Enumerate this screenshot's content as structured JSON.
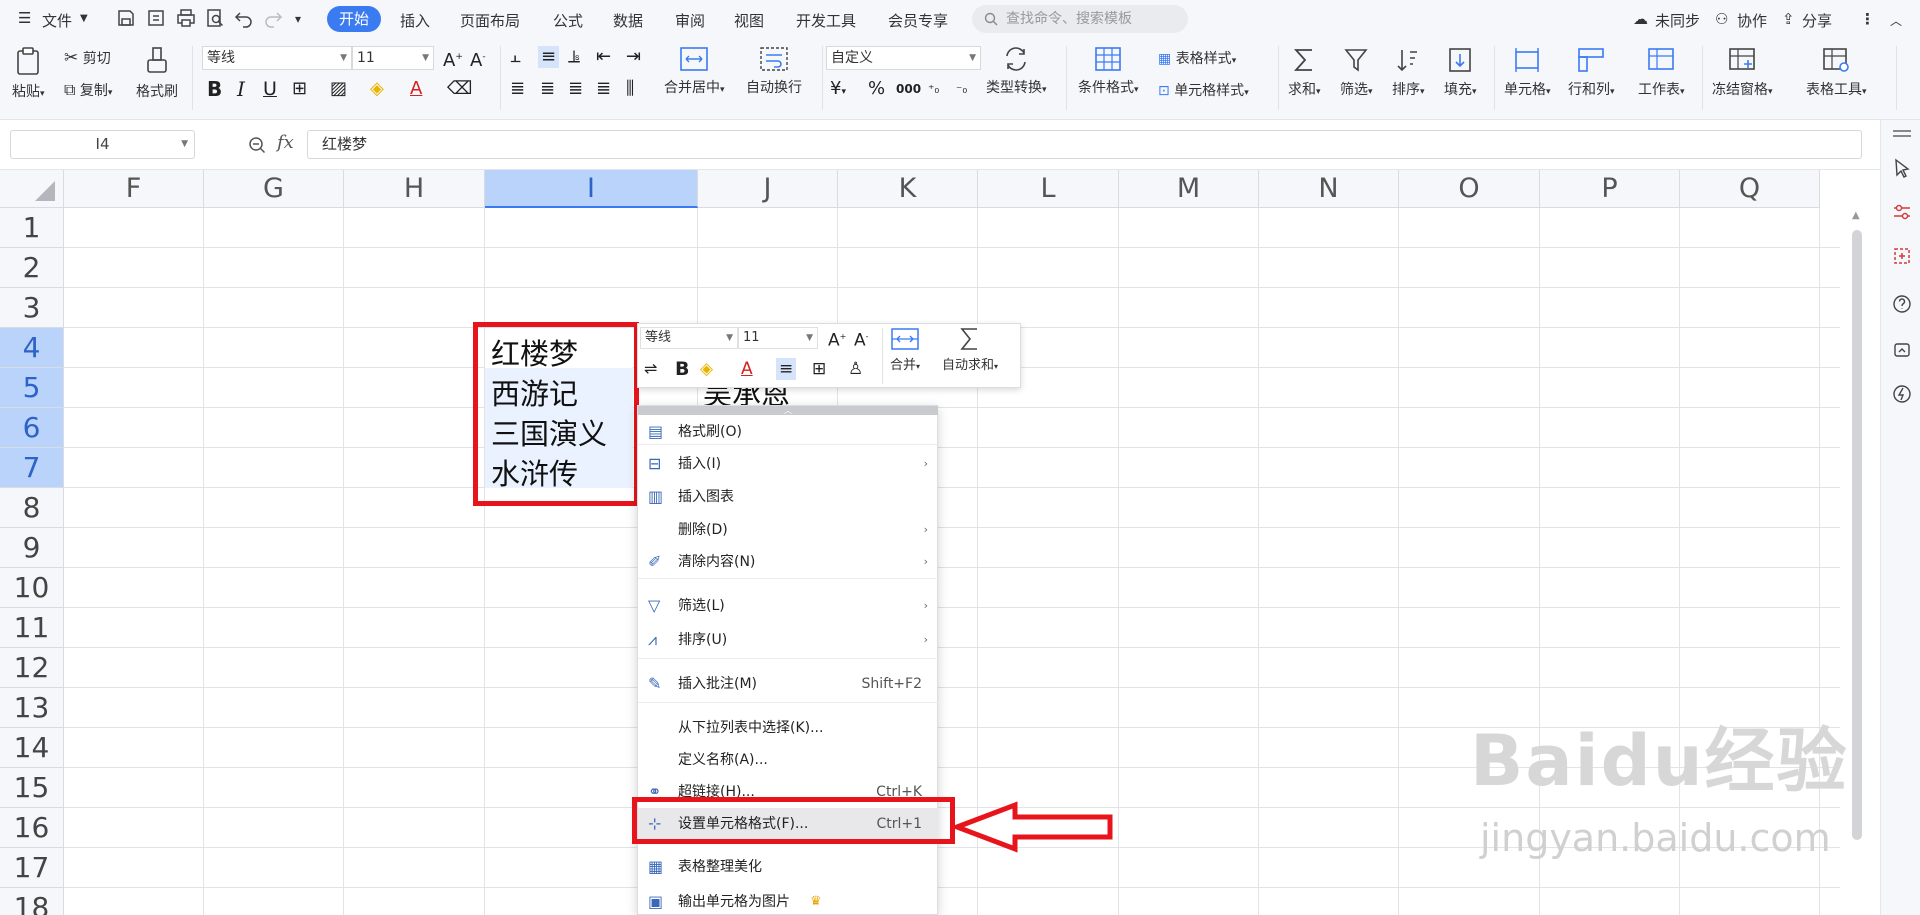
{
  "menubar": {
    "file_label": "文件",
    "tabs": [
      "开始",
      "插入",
      "页面布局",
      "公式",
      "数据",
      "审阅",
      "视图",
      "开发工具",
      "会员专享"
    ],
    "search_placeholder": "查找命令、搜索模板",
    "sync_label": "未同步",
    "collab_label": "协作",
    "share_label": "分享"
  },
  "ribbon": {
    "paste": "粘贴",
    "cut": "剪切",
    "copy": "复制",
    "format_painter": "格式刷",
    "font_name": "等线",
    "font_size": "11",
    "merge_center": "合并居中",
    "wrap_text": "自动换行",
    "number_format": "自定义",
    "type_convert": "类型转换",
    "conditional_format": "条件格式",
    "table_style": "表格样式",
    "cell_style": "单元格样式",
    "sum": "求和",
    "filter": "筛选",
    "sort": "排序",
    "fill": "填充",
    "cell": "单元格",
    "row_col": "行和列",
    "worksheet": "工作表",
    "freeze": "冻结窗格",
    "table_tools": "表格工具",
    "currency_symbol": "¥",
    "percent_symbol": "%",
    "thousands": "000"
  },
  "formula_bar": {
    "name_box": "I4",
    "fx": "fx",
    "content": "红楼梦"
  },
  "columns": [
    "F",
    "G",
    "H",
    "I",
    "J",
    "K",
    "L",
    "M",
    "N",
    "O",
    "P",
    "Q"
  ],
  "rows": [
    "1",
    "2",
    "3",
    "4",
    "5",
    "6",
    "7",
    "8",
    "9",
    "10",
    "11",
    "12",
    "13",
    "14",
    "15",
    "16",
    "17",
    "18"
  ],
  "cells": {
    "I4": "红楼梦",
    "I5": "西游记",
    "I6": "三国演义",
    "I7": "水浒传",
    "J5": "吴承恩"
  },
  "mini_toolbar": {
    "font_name": "等线",
    "font_size": "11",
    "merge": "合并",
    "autosum": "自动求和"
  },
  "context_menu": [
    {
      "label": "格式刷(O)",
      "shortcut": "",
      "submenu": false
    },
    {
      "label": "插入(I)",
      "shortcut": "",
      "submenu": true
    },
    {
      "label": "插入图表",
      "shortcut": "",
      "submenu": false
    },
    {
      "label": "删除(D)",
      "shortcut": "",
      "submenu": true
    },
    {
      "label": "清除内容(N)",
      "shortcut": "",
      "submenu": true
    },
    {
      "label": "筛选(L)",
      "shortcut": "",
      "submenu": true
    },
    {
      "label": "排序(U)",
      "shortcut": "",
      "submenu": true
    },
    {
      "label": "插入批注(M)",
      "shortcut": "Shift+F2",
      "submenu": false
    },
    {
      "label": "从下拉列表中选择(K)...",
      "shortcut": "",
      "submenu": false
    },
    {
      "label": "定义名称(A)...",
      "shortcut": "",
      "submenu": false
    },
    {
      "label": "超链接(H)...",
      "shortcut": "Ctrl+K",
      "submenu": false
    },
    {
      "label": "设置单元格格式(F)...",
      "shortcut": "Ctrl+1",
      "submenu": false
    },
    {
      "label": "表格整理美化",
      "shortcut": "",
      "submenu": false
    },
    {
      "label": "输出单元格为图片",
      "shortcut": "",
      "submenu": false
    }
  ],
  "watermark": {
    "brand": "Baidu经验",
    "url": "jingyan.baidu.com"
  },
  "colors": {
    "accent": "#3a7bf2",
    "highlight_red": "#e8141b",
    "selection": "#b9d3fb"
  }
}
